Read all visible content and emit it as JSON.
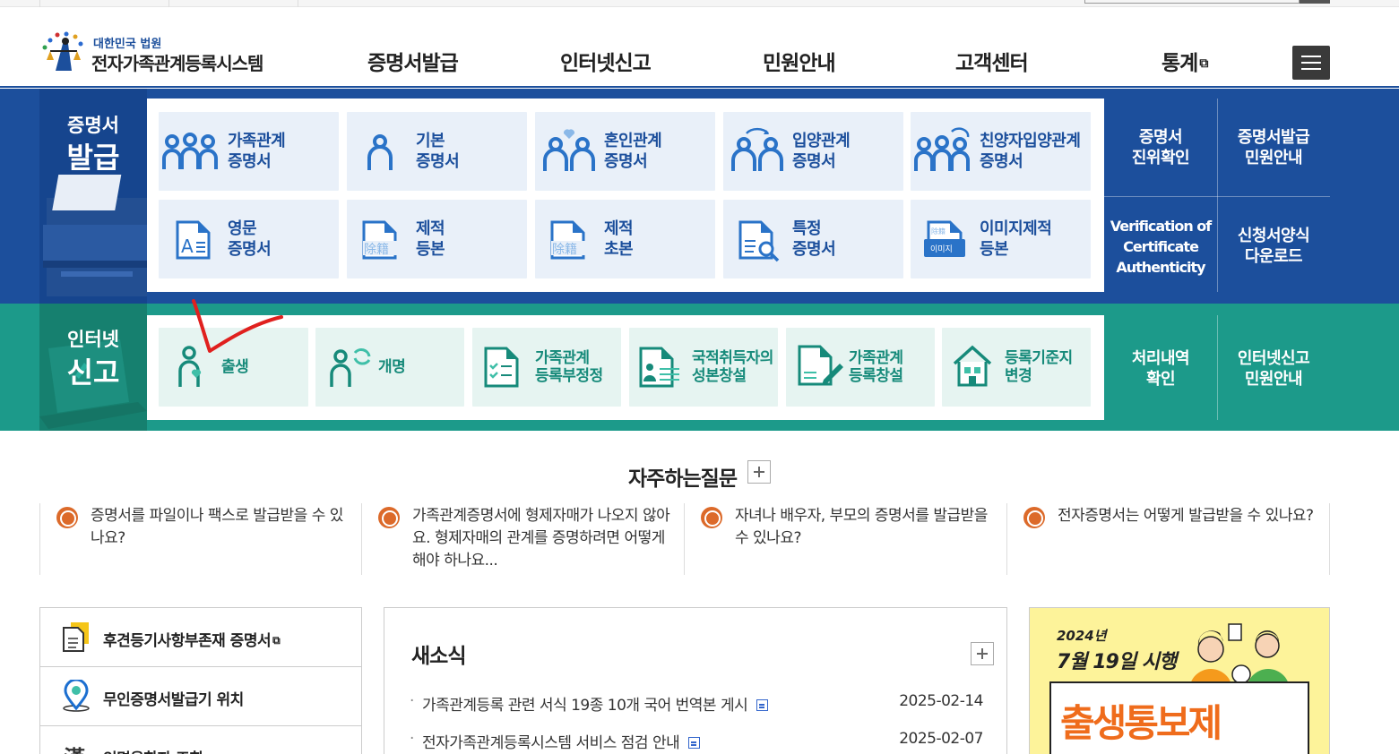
{
  "header": {
    "logo_sub": "대한민국 법원",
    "logo_main": "전자가족관계등록시스템",
    "nav": [
      {
        "label": "증명서발급"
      },
      {
        "label": "인터넷신고"
      },
      {
        "label": "민원안내"
      },
      {
        "label": "고객센터"
      },
      {
        "label": "통계"
      }
    ]
  },
  "certificate": {
    "side_small": "증명서",
    "side_large": "발급",
    "items": [
      {
        "l1": "가족관계",
        "l2": "증명서"
      },
      {
        "l1": "기본",
        "l2": "증명서"
      },
      {
        "l1": "혼인관계",
        "l2": "증명서"
      },
      {
        "l1": "입양관계",
        "l2": "증명서"
      },
      {
        "l1": "친양자입양관계",
        "l2": "증명서"
      },
      {
        "l1": "영문",
        "l2": "증명서"
      },
      {
        "l1": "제적",
        "l2": "등본"
      },
      {
        "l1": "제적",
        "l2": "초본"
      },
      {
        "l1": "특정",
        "l2": "증명서"
      },
      {
        "l1": "이미지제적",
        "l2": "등본"
      }
    ],
    "quick": [
      {
        "l1": "증명서",
        "l2": "진위확인"
      },
      {
        "l1": "증명서발급",
        "l2": "민원안내"
      },
      {
        "l1": "Verification of",
        "l2": "Certificate",
        "l3": "Authenticity"
      },
      {
        "l1": "신청서양식",
        "l2": "다운로드"
      }
    ]
  },
  "report": {
    "side_small": "인터넷",
    "side_large": "신고",
    "items": [
      {
        "l1": "출생",
        "l2": ""
      },
      {
        "l1": "개명",
        "l2": ""
      },
      {
        "l1": "가족관계",
        "l2": "등록부정정"
      },
      {
        "l1": "국적취득자의",
        "l2": "성본창설"
      },
      {
        "l1": "가족관계",
        "l2": "등록창설"
      },
      {
        "l1": "등록기준지",
        "l2": "변경"
      }
    ],
    "quick": [
      {
        "l1": "처리내역",
        "l2": "확인"
      },
      {
        "l1": "인터넷신고",
        "l2": "민원안내"
      }
    ]
  },
  "faq": {
    "title": "자주하는질문",
    "icon_letter": "Q",
    "items": [
      {
        "text": "증명서를 파일이나 팩스로 발급받을 수 있나요?"
      },
      {
        "text": "가족관계증명서에 형제자매가 나오지 않아요. 형제자매의 관계를 증명하려면 어떻게 해야 하나요..."
      },
      {
        "text": "자녀나 배우자, 부모의 증명서를 발급받을 수 있나요?"
      },
      {
        "text": "전자증명서는 어떻게 발급받을 수 있나요?"
      }
    ]
  },
  "links": [
    {
      "label": "후견등기사항부존재 증명서"
    },
    {
      "label": "무인증명서발급기 위치"
    },
    {
      "label": "인명용한자 조회"
    }
  ],
  "news": {
    "title": "새소식",
    "items": [
      {
        "title": "가족관계등록 관련 서식 19종 10개 국어 번역본 게시",
        "date": "2025-02-14"
      },
      {
        "title": "전자가족관계등록시스템 서비스 점검 안내",
        "date": "2025-02-07"
      }
    ]
  },
  "banner": {
    "year": "2024년",
    "date": "7월 19일 시행",
    "headline": "출생통보제"
  },
  "colors": {
    "blue": "#1c4f9c",
    "teal": "#1c9a8a",
    "orange": "#dc6a2a",
    "annotation": "#e0201e"
  }
}
